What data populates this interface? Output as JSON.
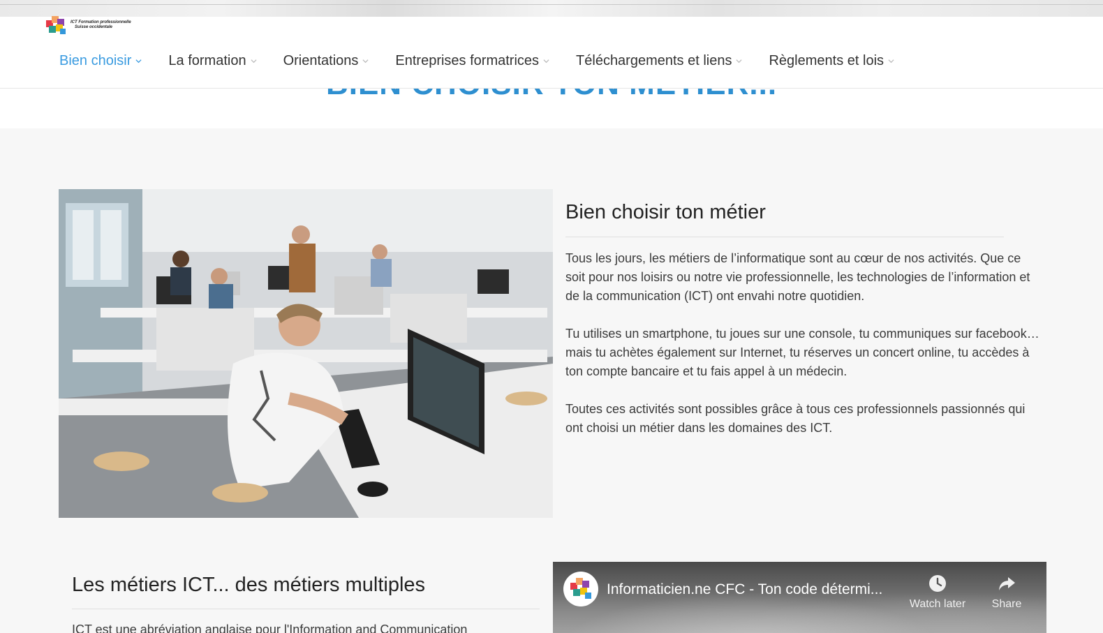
{
  "hero": {
    "title": "BIEN CHOISIR TON MÉTIER..."
  },
  "header": {
    "logo_text_line1": "ICT Formation professionnelle",
    "logo_text_line2": "Suisse occidentale",
    "nav": [
      {
        "label": "Bien choisir",
        "active": true
      },
      {
        "label": "La formation",
        "active": false
      },
      {
        "label": "Orientations",
        "active": false
      },
      {
        "label": "Entreprises formatrices",
        "active": false
      },
      {
        "label": "Téléchargements et liens",
        "active": false
      },
      {
        "label": "Règlements et lois",
        "active": false
      }
    ]
  },
  "section1": {
    "title": "Bien choisir ton métier",
    "paragraphs": [
      "Tous les jours, les métiers de l’informatique sont au cœur de nos activités. Que ce soit pour nos loisirs ou notre vie professionnelle, les technologies de l’information et de la communication (ICT) ont envahi notre quotidien.",
      "Tu utilises un smartphone, tu joues sur une console, tu communiques sur facebook… mais tu achètes également sur Internet, tu réserves un concert online, tu accèdes à ton compte bancaire et tu fais appel à un médecin.",
      "Toutes ces activités sont possibles grâce à tous ces professionnels passionnés qui ont choisi un métier dans les domaines des ICT."
    ]
  },
  "section2": {
    "title": "Les métiers ICT... des métiers multiples",
    "text": "ICT est une abréviation anglaise pour l'Information and Communication"
  },
  "video": {
    "title": "Informaticien.ne CFC - Ton code détermi...",
    "watch_later": "Watch later",
    "share": "Share"
  },
  "colors": {
    "accent": "#3a9be0",
    "hero_title": "#2e8fd0",
    "text": "#333333"
  },
  "icons": {
    "nav_chevron": "chevron-down-icon",
    "watch_later": "clock-icon",
    "share": "share-arrow-icon"
  }
}
